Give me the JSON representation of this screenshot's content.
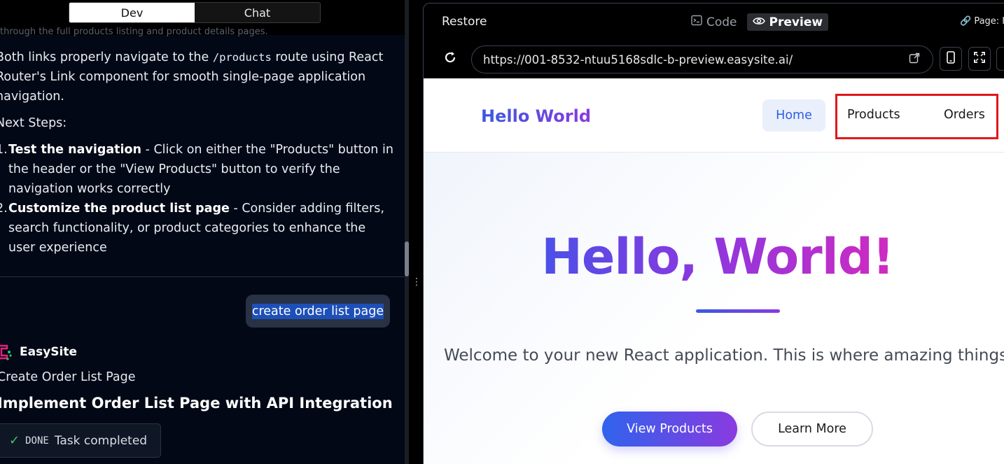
{
  "mode_toggle": {
    "dev": "Dev",
    "chat": "Chat",
    "active": "Dev"
  },
  "chat": {
    "faded_line": "through the full products listing and product details pages.",
    "intro": {
      "before": "Both links properly navigate to the ",
      "code": "/products",
      "after": " route using React Router's Link component for smooth single-page application navigation."
    },
    "next_steps_heading": "Next Steps:",
    "steps": [
      {
        "num": "1.",
        "title": "Test the navigation",
        "text": " - Click on either the \"Products\" button in the header or the \"View Products\" button to verify the navigation works correctly"
      },
      {
        "num": "2.",
        "title": "Customize the product list page",
        "text": " - Consider adding filters, search functionality, or product categories to enhance the user experience"
      }
    ],
    "user_message": "create order list page",
    "assistant_name": "EasySite",
    "task_subtitle": "Create Order List Page",
    "task_title": "Implement Order List Page with API Integration",
    "status": {
      "label": "DONE",
      "text": "Task completed",
      "icon": "check-icon"
    }
  },
  "preview": {
    "restore_label": "Restore",
    "code_label": "Code",
    "preview_label": "Preview",
    "page_label": "Page: H",
    "url": "https://001-8532-ntuu5168sdlc-b-preview.easysite.ai/",
    "site": {
      "logo": "Hello World",
      "nav": {
        "home": "Home",
        "products": "Products",
        "orders": "Orders"
      },
      "hero_title": "Hello, World!",
      "hero_subtitle": "Welcome to your new React application. This is where amazing things begin.",
      "primary_button": "View Products",
      "secondary_button": "Learn More"
    }
  },
  "colors": {
    "chat_bg": "#030816",
    "accent_blue": "#2f63ec",
    "accent_purple": "#8a3ae0",
    "highlight_red": "#e0171c",
    "done_green": "#3ec46d"
  }
}
